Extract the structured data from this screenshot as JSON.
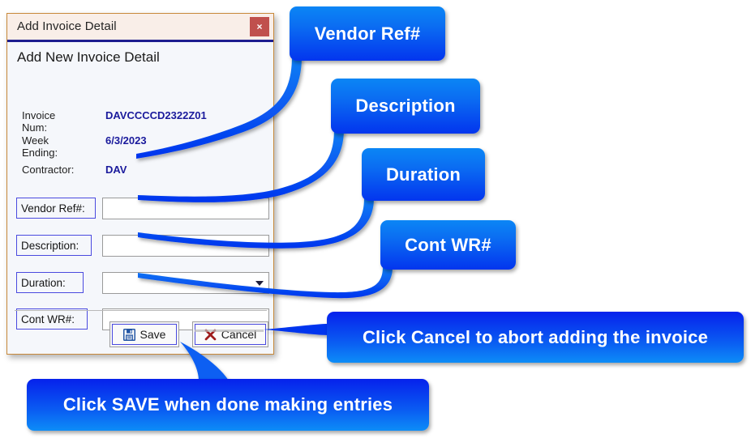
{
  "dialog": {
    "title": "Add Invoice Detail",
    "close_label": "×",
    "heading": "Add New Invoice Detail",
    "info": [
      {
        "label": "Invoice Num:",
        "value": "DAVCCCCD2322Z01"
      },
      {
        "label": "Week Ending:",
        "value": "6/3/2023"
      },
      {
        "label": "Contractor:",
        "value": "DAV"
      }
    ],
    "fields": [
      {
        "label": "Vendor Ref#:",
        "value": "",
        "placeholder": "",
        "type": "text"
      },
      {
        "label": "Description:",
        "value": "",
        "placeholder": "",
        "type": "text"
      },
      {
        "label": "Duration:",
        "value": "",
        "placeholder": "",
        "type": "combobox"
      },
      {
        "label": "Cont WR#:",
        "value": "",
        "placeholder": "",
        "type": "text"
      }
    ],
    "buttons": {
      "save_label": "Save",
      "save_icon": "floppy-disk-icon",
      "cancel_label": "Cancel",
      "cancel_icon": "x-mark-icon"
    }
  },
  "callouts": [
    {
      "id": "vendor",
      "text": "Vendor Ref#"
    },
    {
      "id": "description",
      "text": "Description"
    },
    {
      "id": "duration",
      "text": "Duration"
    },
    {
      "id": "cont-wr",
      "text": "Cont WR#"
    },
    {
      "id": "cancel-hint",
      "text": "Click Cancel to abort adding the invoice"
    },
    {
      "id": "save-hint",
      "text": "Click SAVE when done making entries"
    }
  ],
  "colors": {
    "callout_blue_light": "#0b86f5",
    "callout_blue_dark": "#0335ee",
    "title_bar_bg": "#f9eee8",
    "title_underline": "#1d1d8f",
    "close_button_bg": "#c0504d",
    "dialog_border": "#c8893a",
    "value_text": "#1a1a9c",
    "label_border": "#4a4adf",
    "save_icon_color": "#2255a4",
    "cancel_icon_color": "#9e1b1b"
  }
}
